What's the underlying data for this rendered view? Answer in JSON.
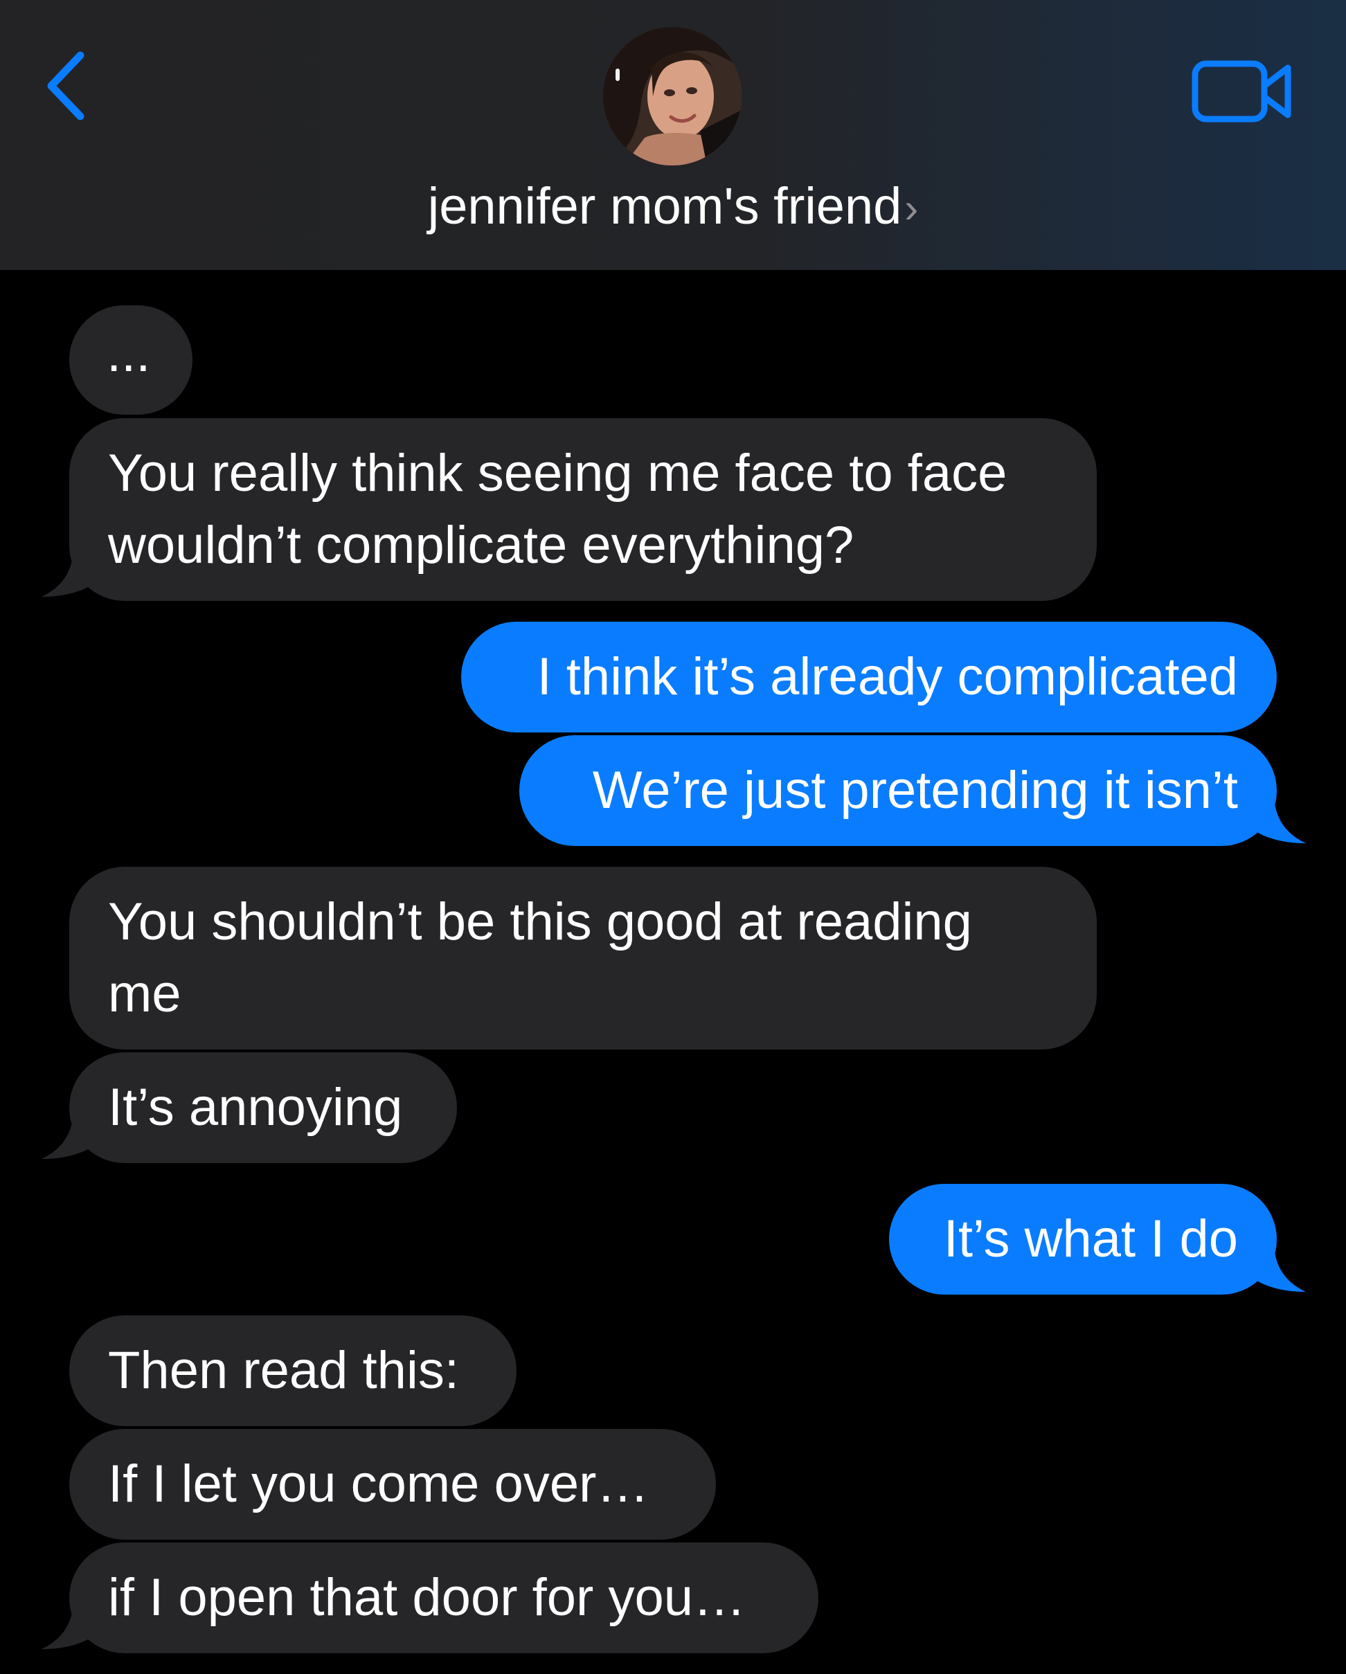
{
  "header": {
    "contact_name": "jennifer mom's friend",
    "chevron": "›",
    "icons": {
      "back": "chevron-left-icon",
      "video": "video-camera-icon"
    },
    "accent_color": "#0a7cff"
  },
  "messages": [
    {
      "direction": "incoming",
      "lines": [
        "..."
      ]
    },
    {
      "direction": "incoming",
      "lines": [
        "You really think seeing me face to face",
        "wouldn’t complicate everything?"
      ]
    },
    {
      "direction": "outgoing",
      "lines": [
        "I think it’s already complicated"
      ]
    },
    {
      "direction": "outgoing",
      "lines": [
        "We’re just pretending it isn’t"
      ]
    },
    {
      "direction": "incoming",
      "lines": [
        "You shouldn’t be this good at reading",
        "me"
      ]
    },
    {
      "direction": "incoming",
      "lines": [
        "It’s annoying"
      ]
    },
    {
      "direction": "outgoing",
      "lines": [
        "It’s what I do"
      ]
    },
    {
      "direction": "incoming",
      "lines": [
        "Then read this:"
      ]
    },
    {
      "direction": "incoming",
      "lines": [
        "If I let you come over…"
      ]
    },
    {
      "direction": "incoming",
      "lines": [
        "if I open that door for you…"
      ]
    }
  ],
  "colors": {
    "incoming_bubble": "#262629",
    "outgoing_bubble": "#0a7cff",
    "background": "#000000"
  }
}
